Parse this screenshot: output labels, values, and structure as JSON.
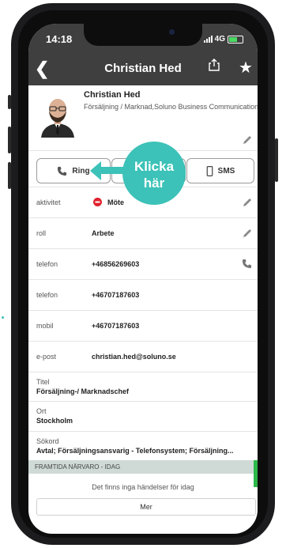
{
  "status": {
    "time": "14:18",
    "network": "4G"
  },
  "nav": {
    "title": "Christian Hed"
  },
  "profile": {
    "name": "Christian Hed",
    "role": "Försäljning / Marknad,Soluno Business Communications"
  },
  "actions": {
    "call_label": "Ring",
    "sms_label": "SMS"
  },
  "callout": {
    "line1": "Klicka",
    "line2": "här"
  },
  "rows": [
    {
      "label": "aktivitet",
      "value": "Möte"
    },
    {
      "label": "roll",
      "value": "Arbete"
    },
    {
      "label": "telefon",
      "value": "+46856269603"
    },
    {
      "label": "telefon",
      "value": "+46707187603"
    },
    {
      "label": "mobil",
      "value": "+46707187603"
    },
    {
      "label": "e-post",
      "value": "christian.hed@soluno.se"
    }
  ],
  "stacked": [
    {
      "label": "Titel",
      "value": "Försäljning-/ Marknadschef"
    },
    {
      "label": "Ort",
      "value": "Stockholm"
    },
    {
      "label": "Sökord",
      "value": "Avtal; Försäljningsansvarig - Telefonsystem; Försäljning..."
    }
  ],
  "presence": {
    "header": "FRAMTIDA NÄRVARO - IDAG",
    "empty_text": "Det finns inga händelser för idag",
    "more_label": "Mer"
  },
  "colors": {
    "accent": "#3cc2b8",
    "topbar": "#3f3f3f",
    "busy_red": "#e0222e",
    "presence_green": "#2db84a"
  }
}
